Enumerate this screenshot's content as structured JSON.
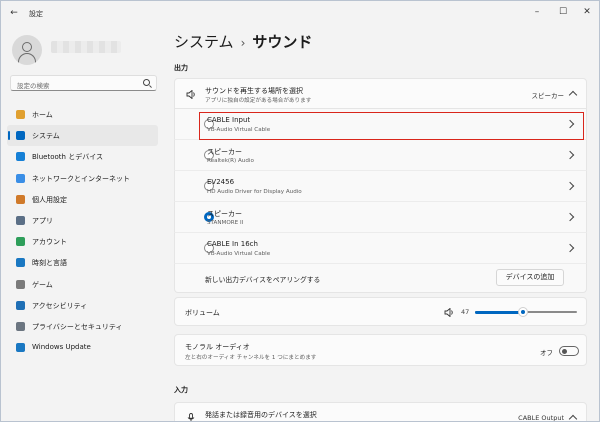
{
  "app": {
    "title": "設定"
  },
  "user": {
    "name_blurred": true
  },
  "search": {
    "placeholder": "設定の検索"
  },
  "nav": [
    {
      "label": "ホーム",
      "icon": "home-icon",
      "color": "#e0a030",
      "active": false
    },
    {
      "label": "システム",
      "icon": "system-icon",
      "color": "#0067c0",
      "active": true
    },
    {
      "label": "Bluetooth とデバイス",
      "icon": "bluetooth-icon",
      "color": "#1680d6",
      "active": false
    },
    {
      "label": "ネットワークとインターネット",
      "icon": "wifi-icon",
      "color": "#3a8ee6",
      "active": false
    },
    {
      "label": "個人用設定",
      "icon": "brush-icon",
      "color": "#d07a2a",
      "active": false
    },
    {
      "label": "アプリ",
      "icon": "apps-icon",
      "color": "#5b6f86",
      "active": false
    },
    {
      "label": "アカウント",
      "icon": "account-icon",
      "color": "#2e9e5a",
      "active": false
    },
    {
      "label": "時刻と言語",
      "icon": "time-language-icon",
      "color": "#1a78c2",
      "active": false
    },
    {
      "label": "ゲーム",
      "icon": "gaming-icon",
      "color": "#7a7a7a",
      "active": false
    },
    {
      "label": "アクセシビリティ",
      "icon": "accessibility-icon",
      "color": "#1f6fb5",
      "active": false
    },
    {
      "label": "プライバシーとセキュリティ",
      "icon": "shield-icon",
      "color": "#6b7580",
      "active": false
    },
    {
      "label": "Windows Update",
      "icon": "update-icon",
      "color": "#1a78c2",
      "active": false
    }
  ],
  "breadcrumb": {
    "parent": "システム",
    "separator": "›",
    "current": "サウンド"
  },
  "output": {
    "section_label": "出力",
    "select_title": "サウンドを再生する場所を選択",
    "select_sub": "アプリに独自の設定がある場合があります",
    "selected_value": "スピーカー",
    "devices": [
      {
        "name": "CABLE Input",
        "detail": "VB-Audio Virtual Cable",
        "selected": false,
        "highlighted": true
      },
      {
        "name": "スピーカー",
        "detail": "Realtek(R) Audio",
        "selected": false,
        "highlighted": false
      },
      {
        "name": "EV2456",
        "detail": "HD Audio Driver for Display Audio",
        "selected": false,
        "highlighted": false
      },
      {
        "name": "スピーカー",
        "detail": "STANMORE II",
        "selected": true,
        "highlighted": false
      },
      {
        "name": "CABLE In 16ch",
        "detail": "VB-Audio Virtual Cable",
        "selected": false,
        "highlighted": false
      }
    ],
    "pair_label": "新しい出力デバイスをペアリングする",
    "add_device_button": "デバイスの追加",
    "volume_label": "ボリューム",
    "volume_value": "47",
    "mono_title": "モノラル オーディオ",
    "mono_sub": "左と右のオーディオ チャンネルを 1 つにまとめます",
    "mono_state": "オフ"
  },
  "input": {
    "section_label": "入力",
    "select_title": "発話または録音用のデバイスを選択",
    "selected_value": "CABLE Output"
  },
  "colors": {
    "accent": "#0067c0",
    "highlight": "#d9261c"
  }
}
